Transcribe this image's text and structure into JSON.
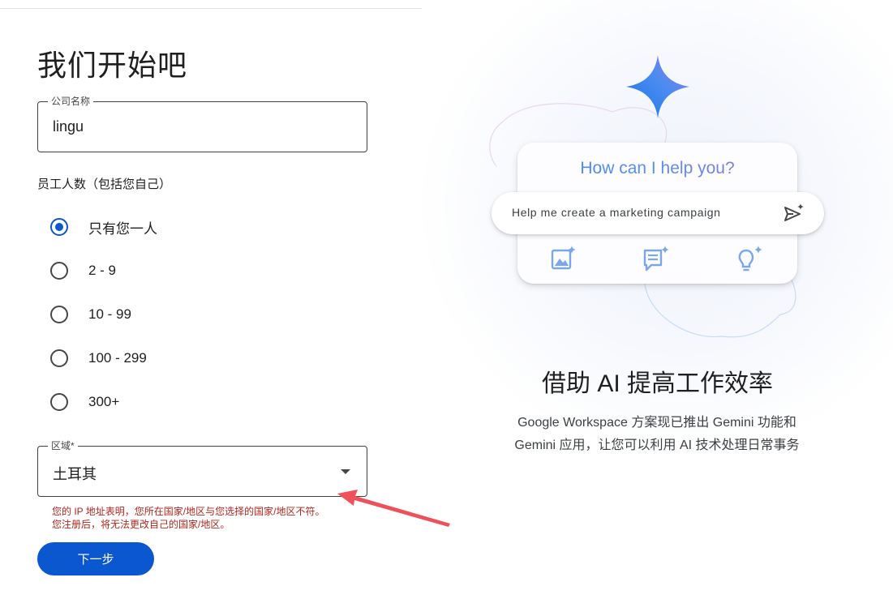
{
  "page": {
    "title": "我们开始吧"
  },
  "company_field": {
    "legend": "公司名称",
    "value": "lingu"
  },
  "employees": {
    "label": "员工人数（包括您自己）",
    "options": [
      {
        "label": "只有您一人",
        "selected": true
      },
      {
        "label": "2 - 9",
        "selected": false
      },
      {
        "label": "10 - 99",
        "selected": false
      },
      {
        "label": "100 - 299",
        "selected": false
      },
      {
        "label": "300+",
        "selected": false
      }
    ]
  },
  "region_field": {
    "legend": "区域*",
    "value": "土耳其",
    "error_line1": "您的 IP 地址表明，您所在国家/地区与您选择的国家/地区不符。",
    "error_line2": "您注册后，将无法更改自己的国家/地区。"
  },
  "next_button": {
    "label": "下一步"
  },
  "promo": {
    "card_question": "How can I help you?",
    "prompt_text": "Help me create a marketing campaign",
    "card_icons": [
      "image-sparkle-icon",
      "chat-sparkle-icon",
      "lightbulb-sparkle-icon"
    ],
    "heading": "借助 AI 提高工作效率",
    "description_line1": "Google Workspace 方案现已推出 Gemini 功能和",
    "description_line2": "Gemini 应用，让您可以利用 AI 技术处理日常事务"
  },
  "colors": {
    "primary": "#0b57d0",
    "error": "#b3261e",
    "annotation_arrow": "#f0505a"
  }
}
